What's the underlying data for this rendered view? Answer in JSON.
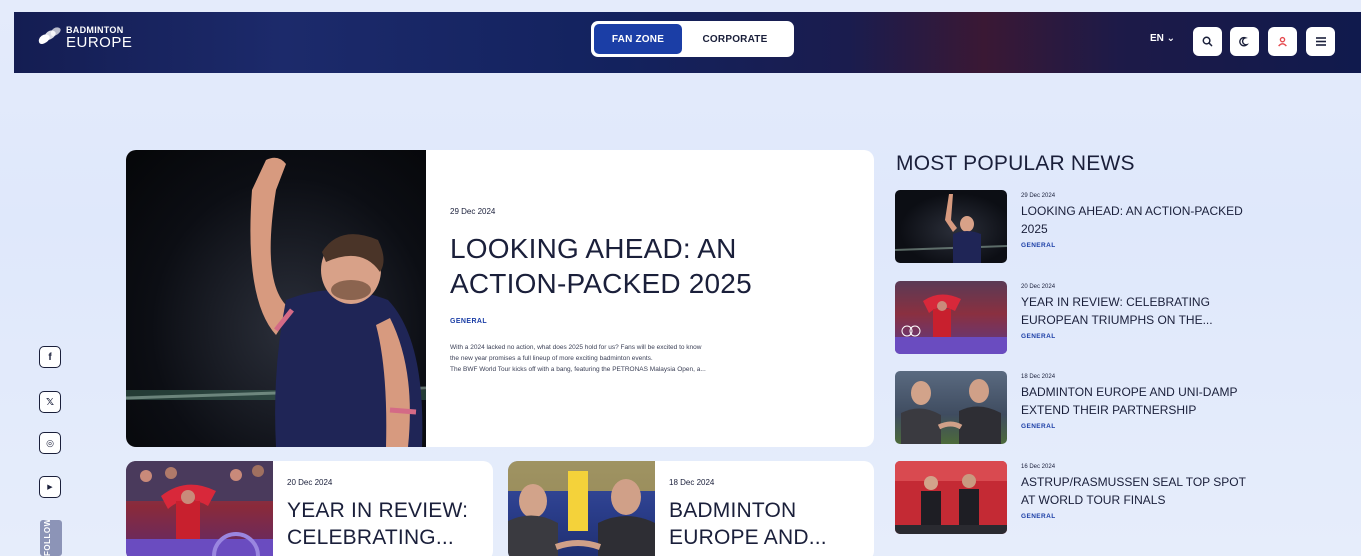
{
  "header": {
    "logo": {
      "line1": "BADMINTON",
      "line2": "EUROPE"
    },
    "zones": {
      "fan_zone": "FAN ZONE",
      "corporate": "CORPORATE"
    },
    "language": "EN ⌄",
    "icons": [
      "search-icon",
      "dark-mode-icon",
      "user-icon",
      "menu-icon"
    ]
  },
  "social": {
    "facebook": "f",
    "x": "𝕏",
    "instagram": "◎",
    "youtube": "▶",
    "follow_label": "FOLLOW US"
  },
  "featured": {
    "date": "29 Dec 2024",
    "title": "LOOKING AHEAD: AN ACTION-PACKED 2025",
    "category": "GENERAL",
    "excerpt_line1": "With a 2024 lacked no action, what does 2025 hold for us? Fans will be excited to know",
    "excerpt_line2": "the new year promises a full lineup of more exciting badminton events.",
    "excerpt_line3": "The BWF World Tour kicks off with a bang, featuring the PETRONAS Malaysia Open, a..."
  },
  "cards": [
    {
      "date": "20 Dec 2024",
      "title_line1": "YEAR IN REVIEW:",
      "title_line2": "CELEBRATING..."
    },
    {
      "date": "18 Dec 2024",
      "title_line1": "BADMINTON",
      "title_line2": "EUROPE AND..."
    }
  ],
  "popular": {
    "heading": "MOST POPULAR NEWS",
    "items": [
      {
        "date": "29 Dec 2024",
        "title": "LOOKING AHEAD: AN ACTION-PACKED 2025",
        "category": "GENERAL"
      },
      {
        "date": "20 Dec 2024",
        "title": "YEAR IN REVIEW: CELEBRATING EUROPEAN TRIUMPHS ON THE...",
        "category": "GENERAL"
      },
      {
        "date": "18 Dec 2024",
        "title": "BADMINTON EUROPE AND UNI-DAMP EXTEND THEIR PARTNERSHIP",
        "category": "GENERAL"
      },
      {
        "date": "16 Dec 2024",
        "title": "ASTRUP/RASMUSSEN SEAL TOP SPOT AT WORLD TOUR FINALS",
        "category": "GENERAL"
      }
    ]
  },
  "colors": {
    "accent": "#1b3ea6",
    "header_bg": "#141d52",
    "page_bg": "#e4ebfb"
  }
}
